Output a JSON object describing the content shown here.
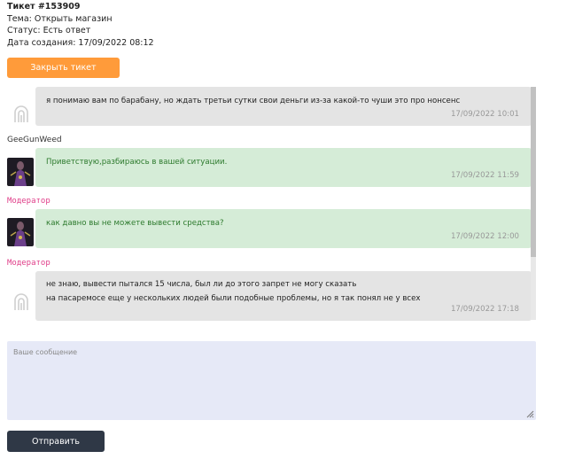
{
  "ticket": {
    "title": "Тикет #153909",
    "subject": "Тема: Открыть магазин",
    "status": "Статус: Есть ответ",
    "created": "Дата создания: 17/09/2022 08:12",
    "close_label": "Закрыть тикет"
  },
  "messages": [
    {
      "role": "user",
      "lines": [
        "я понимаю вам по барабану, но ждать третьи сутки свои деньги из-за какой-то чуши это про нонсенс"
      ],
      "time": "17/09/2022 10:01",
      "author": "GeeGunWeed"
    },
    {
      "role": "moderator",
      "lines": [
        "Приветствую,разбираюсь в вашей ситуации."
      ],
      "time": "17/09/2022 11:59",
      "author": "Модератор"
    },
    {
      "role": "moderator",
      "lines": [
        "как давно вы не можете вывести средства?"
      ],
      "time": "17/09/2022 12:00",
      "author": "Модератор"
    },
    {
      "role": "user",
      "lines": [
        "не знаю, вывести пытался 15 числа, был ли до этого запрет не могу сказать",
        "на пасаремосе еще у нескольких людей были подобные проблемы, но я так понял не у всех"
      ],
      "time": "17/09/2022 17:18"
    }
  ],
  "composer": {
    "placeholder": "Ваше сообщение",
    "send_label": "Отправить"
  },
  "colors": {
    "close_button": "#ff9b3a",
    "send_button": "#2f3846",
    "moderator_bubble": "#d5ecd7",
    "user_bubble": "#e4e4e4",
    "moderator_role": "#e0408a"
  },
  "icons": {
    "user_avatar": "user-logo-icon",
    "moderator_avatar": "moderator-avatar"
  }
}
